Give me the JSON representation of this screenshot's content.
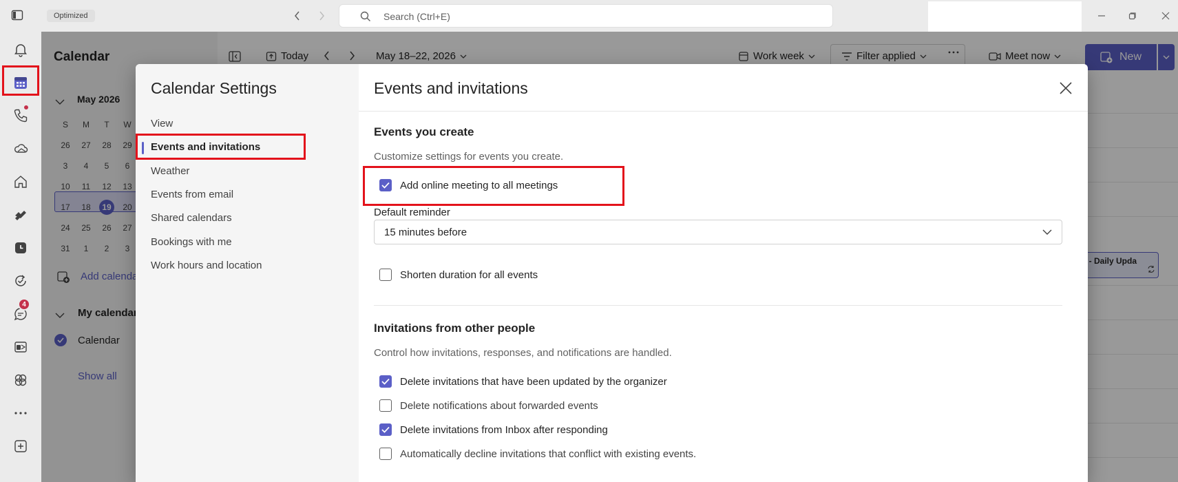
{
  "titlebar": {
    "tag": "Optimized",
    "search_placeholder": "Search (Ctrl+E)"
  },
  "rail": {
    "chat_badge": "4"
  },
  "calendar": {
    "title": "Calendar",
    "mini_month": "May 2026",
    "weekdays": [
      "S",
      "M",
      "T",
      "W"
    ],
    "weeks": [
      [
        "26",
        "27",
        "28",
        "29"
      ],
      [
        "3",
        "4",
        "5",
        "6"
      ],
      [
        "10",
        "11",
        "12",
        "13"
      ],
      [
        "17",
        "18",
        "19",
        "20"
      ],
      [
        "24",
        "25",
        "26",
        "27"
      ],
      [
        "31",
        "1",
        "2",
        "3"
      ]
    ],
    "today": "19",
    "add_calendar": "Add calenda",
    "my_calendars": "My calendar",
    "calendar_item": "Calendar",
    "show_all": "Show all",
    "toolbar": {
      "today": "Today",
      "date_range": "May 18–22, 2026",
      "view": "Work week",
      "filter": "Filter applied",
      "meet_now": "Meet now",
      "new": "New"
    },
    "event_chip": "g - Daily Upda"
  },
  "dialog": {
    "left_title": "Calendar Settings",
    "nav": [
      {
        "label": "View",
        "active": false
      },
      {
        "label": "Events and invitations",
        "active": true
      },
      {
        "label": "Weather",
        "active": false
      },
      {
        "label": "Events from email",
        "active": false
      },
      {
        "label": "Shared calendars",
        "active": false
      },
      {
        "label": "Bookings with me",
        "active": false
      },
      {
        "label": "Work hours and location",
        "active": false
      }
    ],
    "right_title": "Events and invitations",
    "events_you_create": {
      "title": "Events you create",
      "desc": "Customize settings for events you create.",
      "add_online_meeting": {
        "label": "Add online meeting to all meetings",
        "checked": true
      },
      "default_reminder_label": "Default reminder",
      "default_reminder_value": "15 minutes before",
      "shorten_duration": {
        "label": "Shorten duration for all events",
        "checked": false
      }
    },
    "invitations": {
      "title": "Invitations from other people",
      "desc": "Control how invitations, responses, and notifications are handled.",
      "options": [
        {
          "label": "Delete invitations that have been updated by the organizer",
          "checked": true
        },
        {
          "label": "Delete notifications about forwarded events",
          "checked": false
        },
        {
          "label": "Delete invitations from Inbox after responding",
          "checked": true
        },
        {
          "label": "Automatically decline invitations that conflict with existing events.",
          "checked": false
        }
      ]
    }
  },
  "colors": {
    "accent": "#5b5fc7",
    "highlight": "#e3121b",
    "badge": "#c4314b"
  }
}
